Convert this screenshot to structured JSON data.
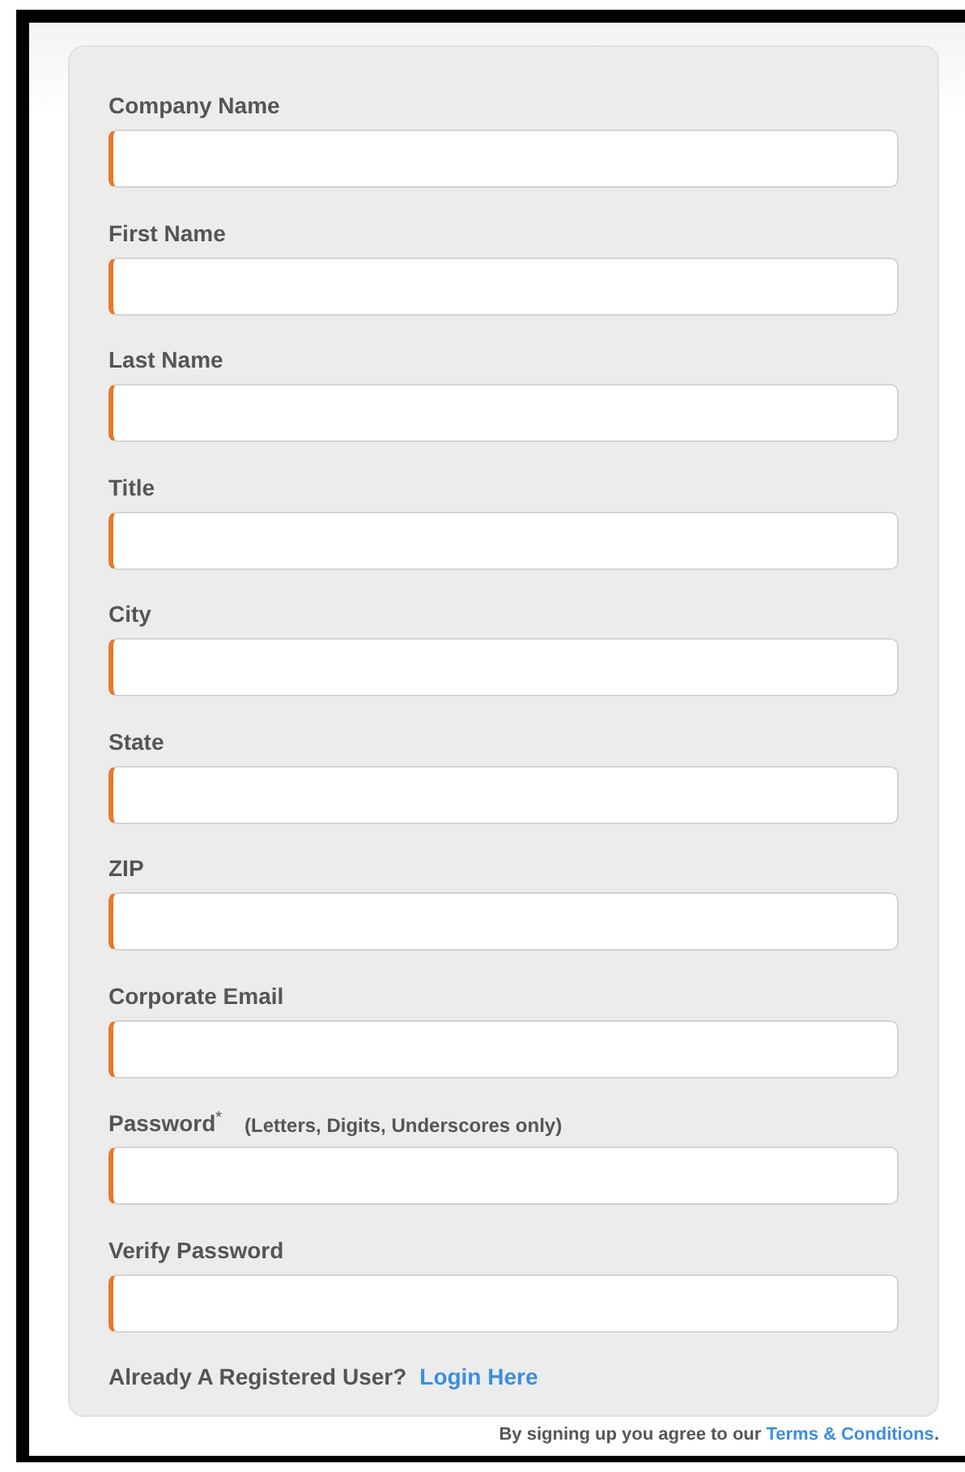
{
  "fields": [
    {
      "label": "Company Name"
    },
    {
      "label": "First Name"
    },
    {
      "label": "Last Name"
    },
    {
      "label": "Title"
    },
    {
      "label": "City"
    },
    {
      "label": "State"
    },
    {
      "label": "ZIP"
    },
    {
      "label": "Corporate Email"
    },
    {
      "label": "Password$^{*}$",
      "hint": "(Letters, Digits, Underscores only)"
    },
    {
      "label": "Verify Password"
    }
  ],
  "login": {
    "question": "Already A Registered User?",
    "link": "Login Here"
  },
  "footer": {
    "text": "By signing up you agree to our",
    "link": "Terms & Conditions",
    "end": "."
  }
}
